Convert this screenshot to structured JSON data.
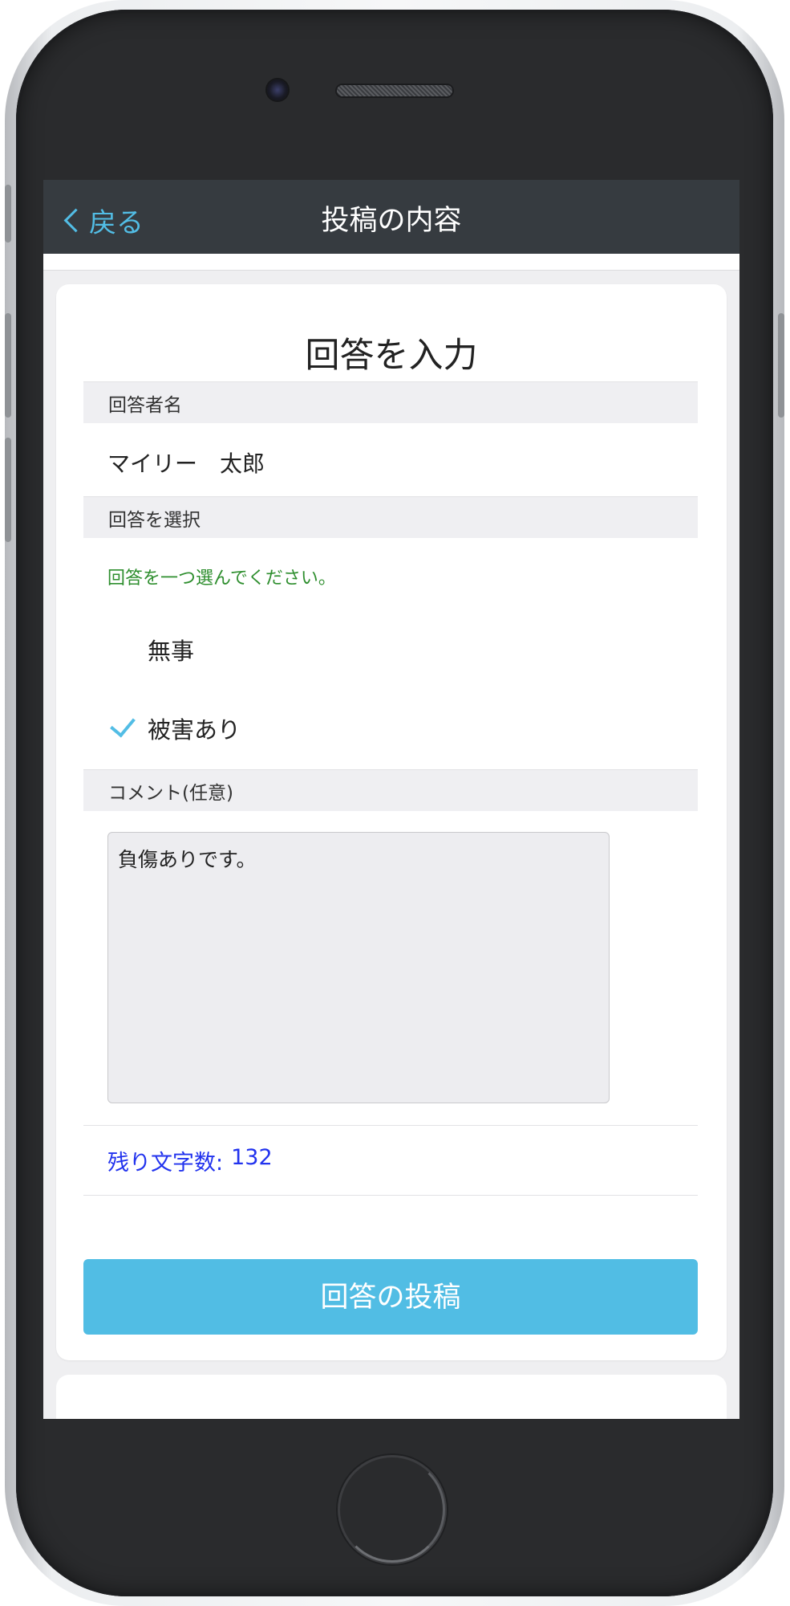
{
  "nav": {
    "back_label": "戻る",
    "title": "投稿の内容"
  },
  "form": {
    "title": "回答を入力",
    "respondent_section_label": "回答者名",
    "respondent_name": "マイリー　太郎",
    "select_section_label": "回答を選択",
    "select_hint": "回答を一つ選んでください。",
    "options": [
      {
        "label": "無事",
        "selected": false
      },
      {
        "label": "被害あり",
        "selected": true
      }
    ],
    "comment_section_label": "コメント(任意)",
    "comment_value": "負傷ありです。",
    "remaining_label": "残り文字数:",
    "remaining_count": "132",
    "submit_label": "回答の投稿"
  },
  "colors": {
    "nav_bg": "#363b40",
    "accent": "#51bde4",
    "hint_green": "#2e8e2e",
    "count_blue": "#2233ee"
  },
  "icons": [
    "back-chevron-icon",
    "checkmark-icon",
    "camera-icon",
    "speaker-icon",
    "home-button-icon"
  ]
}
